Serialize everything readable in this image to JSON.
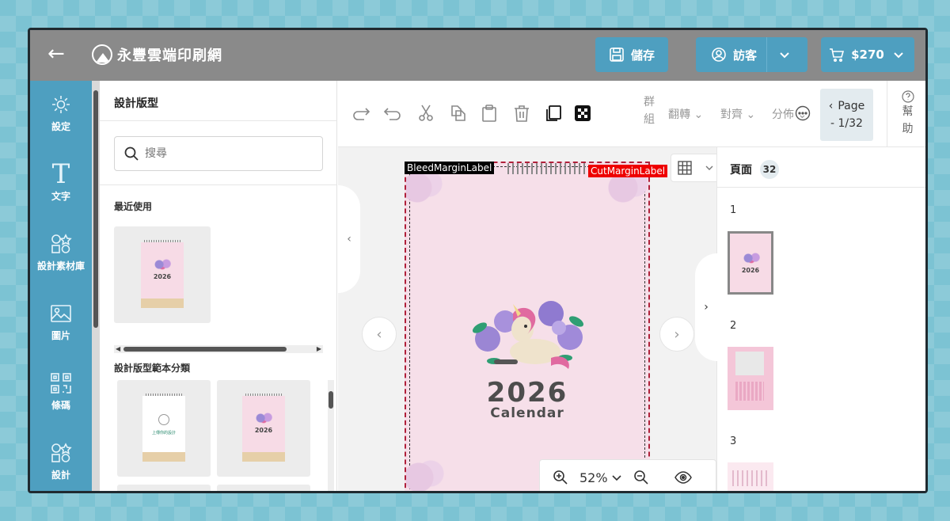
{
  "topbar": {
    "back_icon": "arrow-left-icon",
    "brand": "永豐雲端印刷網",
    "save_label": "儲存",
    "guest_label": "訪客",
    "cart_label": "$270"
  },
  "sidebar": {
    "items": [
      {
        "label": "設定",
        "icon": "gear-icon"
      },
      {
        "label": "文字",
        "icon": "text-icon"
      },
      {
        "label": "設計素材庫",
        "icon": "shapes-icon"
      },
      {
        "label": "圖片",
        "icon": "image-icon"
      },
      {
        "label": "條碼",
        "icon": "qrcode-icon"
      },
      {
        "label": "設計",
        "icon": "shapes-icon"
      }
    ]
  },
  "panel": {
    "title": "設計版型",
    "search_placeholder": "搜尋",
    "recent_title": "最近使用",
    "category_title": "設計版型範本分類",
    "upload_text": "上傳你的設計"
  },
  "toolbar": {
    "group_top": "群",
    "group_bottom": "組",
    "flip_label": "翻轉",
    "align_label": "對齊",
    "distribute_label": "分佈",
    "page_label": "Page",
    "page_counter": "- 1/32",
    "help_top": "幫",
    "help_bottom": "助"
  },
  "canvas": {
    "bleed_label": "BleedMarginLabel",
    "cut_label": "CutMarginLabel",
    "year": "2026",
    "subtitle": "Calendar",
    "zoom": "52%"
  },
  "pages": {
    "title": "頁面",
    "count": "32",
    "numbers": [
      "1",
      "2",
      "3"
    ]
  },
  "colors": {
    "accent": "#4e9fc0",
    "topbar": "#8a8a8a",
    "sheet": "#f6dfe9"
  }
}
